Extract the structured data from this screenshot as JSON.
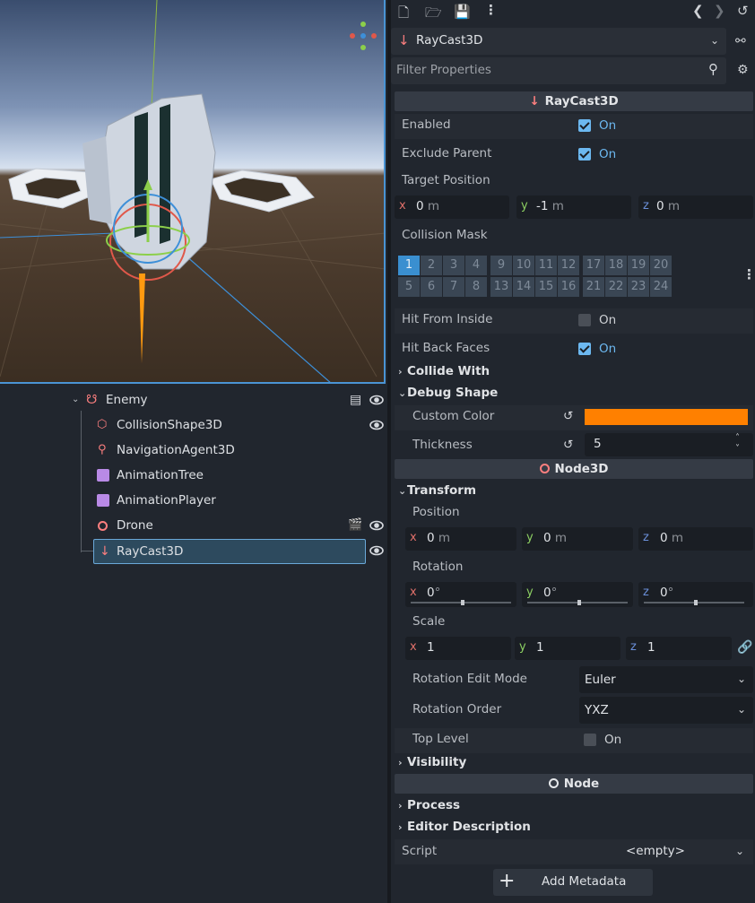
{
  "scene_tree": {
    "root": "Enemy",
    "children": [
      "CollisionShape3D",
      "NavigationAgent3D",
      "AnimationTree",
      "AnimationPlayer",
      "Drone",
      "RayCast3D"
    ],
    "selected": "RayCast3D"
  },
  "inspector": {
    "node_selector": "RayCast3D",
    "filter_placeholder": "Filter Properties",
    "categories": {
      "raycast": "RayCast3D",
      "node3d": "Node3D",
      "node": "Node"
    },
    "raycast": {
      "enabled_label": "Enabled",
      "enabled_value": "On",
      "exclude_parent_label": "Exclude Parent",
      "exclude_parent_value": "On",
      "target_position_label": "Target Position",
      "target_x": "0",
      "target_y": "-1",
      "target_z": "0",
      "unit_m": "m",
      "collision_mask_label": "Collision Mask",
      "mask_row1": [
        "1",
        "2",
        "3",
        "4",
        "9",
        "10",
        "11",
        "12",
        "17",
        "18",
        "19",
        "20"
      ],
      "mask_row2": [
        "5",
        "6",
        "7",
        "8",
        "13",
        "14",
        "15",
        "16",
        "21",
        "22",
        "23",
        "24"
      ],
      "hit_from_inside_label": "Hit From Inside",
      "hit_from_inside_value": "On",
      "hit_back_faces_label": "Hit Back Faces",
      "hit_back_faces_value": "On",
      "collide_with": "Collide With",
      "debug_shape": "Debug Shape",
      "custom_color_label": "Custom Color",
      "custom_color": "#ff8000",
      "thickness_label": "Thickness",
      "thickness_value": "5"
    },
    "node3d": {
      "transform": "Transform",
      "position_label": "Position",
      "pos_x": "0",
      "pos_y": "0",
      "pos_z": "0",
      "unit_m": "m",
      "rotation_label": "Rotation",
      "rot_x": "0",
      "rot_y": "0",
      "rot_z": "0",
      "unit_deg": "°",
      "scale_label": "Scale",
      "scale_x": "1",
      "scale_y": "1",
      "scale_z": "1",
      "rotation_edit_mode_label": "Rotation Edit Mode",
      "rotation_edit_mode_value": "Euler",
      "rotation_order_label": "Rotation Order",
      "rotation_order_value": "YXZ",
      "top_level_label": "Top Level",
      "top_level_value": "On",
      "visibility": "Visibility"
    },
    "node": {
      "process": "Process",
      "editor_description": "Editor Description",
      "script_label": "Script",
      "script_value": "<empty>",
      "add_metadata": "Add Metadata"
    }
  },
  "colors": {
    "accent": "#4a94d4",
    "checkbox_on": "#6cb8f0",
    "node3d_icon": "#fc7f7f",
    "raycast_icon": "#fc7f7f"
  }
}
